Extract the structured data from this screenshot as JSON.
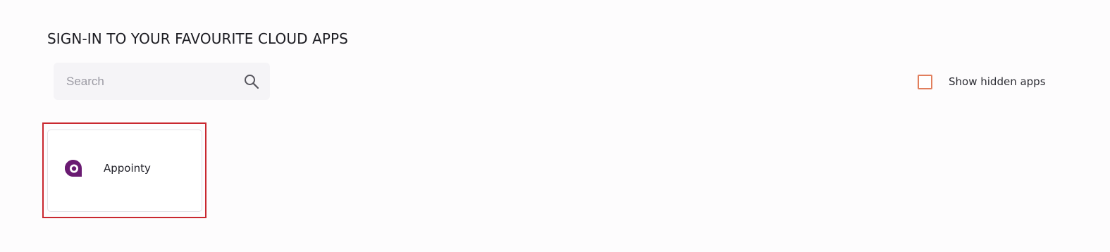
{
  "header": {
    "title": "SIGN-IN TO YOUR FAVOURITE CLOUD APPS"
  },
  "search": {
    "placeholder": "Search",
    "value": "",
    "icon": "search-icon"
  },
  "filters": {
    "show_hidden_label": "Show hidden apps",
    "show_hidden_checked": false
  },
  "apps": [
    {
      "name": "Appointy",
      "icon": "appointy-logo-icon",
      "selected": true
    }
  ],
  "colors": {
    "checkbox_border": "#e17e5c",
    "highlight_border": "#c9272f",
    "appointy_brand": "#6a1b72"
  }
}
